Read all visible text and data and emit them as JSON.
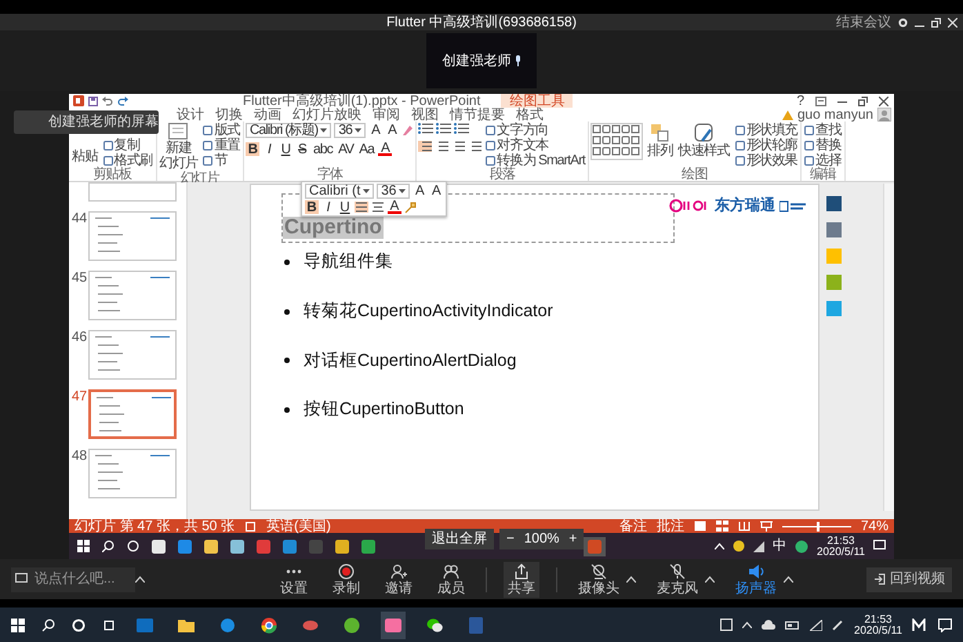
{
  "meeting": {
    "title": "Flutter 中高级培训(693686158)",
    "end_meeting": "结束会议",
    "video_tile_name": "创建强老师",
    "share_tooltip": "创建强老师的屏幕"
  },
  "powerpoint": {
    "title": "Flutter中高级培训(1).pptx - PowerPoint",
    "context_tab": "绘图工具",
    "help": "?",
    "user": "guo manyun",
    "tabs": [
      {
        "label": "设计",
        "selected": false
      },
      {
        "label": "切换",
        "selected": false
      },
      {
        "label": "动画",
        "selected": false
      },
      {
        "label": "幻灯片放映",
        "selected": false
      },
      {
        "label": "审阅",
        "selected": false
      },
      {
        "label": "视图",
        "selected": false
      },
      {
        "label": "情节提要",
        "selected": false
      },
      {
        "label": "格式",
        "selected": false
      }
    ],
    "ribbon": [
      {
        "kind": "clipboard",
        "label": "剪贴板",
        "large": [
          "粘贴"
        ],
        "small": [
          "复制",
          "格式刷"
        ]
      },
      {
        "kind": "slides",
        "label": "幻灯片",
        "large": [
          "新建",
          "幻灯片"
        ],
        "small": [
          "版式",
          "重置",
          "节"
        ]
      },
      {
        "kind": "font",
        "label": "字体",
        "font_name": "Calibri (标题)",
        "font_size": "36",
        "size_buttons": [
          "A",
          "A"
        ],
        "format_buttons": [
          "B",
          "I",
          "U",
          "S",
          "abc",
          "AV",
          "Aa",
          "A"
        ]
      },
      {
        "kind": "paragraph",
        "label": "段落",
        "small": [
          "文字方向",
          "对齐文本",
          "转换为 SmartArt"
        ]
      },
      {
        "kind": "drawing",
        "label": "绘图",
        "large": [
          "排列",
          "快速样式"
        ],
        "small": [
          "形状填充",
          "形状轮廓",
          "形状效果"
        ]
      },
      {
        "kind": "editing",
        "label": "编辑",
        "small": [
          "查找",
          "替换",
          "选择"
        ]
      }
    ],
    "mini_toolbar": {
      "font_name": "Calibri (t",
      "font_size": "36",
      "size_buttons": [
        "A",
        "A"
      ],
      "format_buttons": [
        "B",
        "I",
        "U"
      ],
      "font_color": "A"
    },
    "thumbnails": [
      {
        "number": "44",
        "selected": false
      },
      {
        "number": "45",
        "selected": false
      },
      {
        "number": "46",
        "selected": false
      },
      {
        "number": "47",
        "selected": true
      },
      {
        "number": "48",
        "selected": false
      }
    ],
    "slide": {
      "title": "Cupertino",
      "title_selected": true,
      "logo_text": "东方瑞通",
      "bullets": [
        "导航组件集",
        "转菊花CupertinoActivityIndicator",
        "对话框CupertinoAlertDialog",
        "按钮CupertinoButton"
      ]
    },
    "swatches": [
      {
        "color": "#1f4e79"
      },
      {
        "color": "#6d7b8d"
      },
      {
        "color": "#ffc000"
      },
      {
        "color": "#8cb21b"
      },
      {
        "color": "#1ea7e1"
      }
    ],
    "status_bar": {
      "slide_info": "幻灯片 第 47 张，共 50 张",
      "language": "英语(美国)",
      "notes": "备注",
      "comments": "批注",
      "zoom_slider": {
        "level": 0.5
      },
      "zoom": "74%"
    }
  },
  "share_controls": {
    "exit_fullscreen": "退出全屏",
    "zoom_out": "−",
    "zoom": "100%",
    "zoom_in": "+"
  },
  "remote_taskbar": {
    "ime": "中",
    "time": "21:53",
    "date": "2020/5/11"
  },
  "toolbar": {
    "chat_placeholder": "说点什么吧...",
    "actions": [
      {
        "kind": "settings",
        "label": "设置"
      },
      {
        "kind": "record",
        "label": "录制"
      },
      {
        "kind": "invite",
        "label": "邀请"
      },
      {
        "kind": "members",
        "label": "成员"
      }
    ],
    "share": {
      "label": "共享",
      "selected": true
    },
    "devices": [
      {
        "kind": "camera",
        "label": "摄像头",
        "on": false
      },
      {
        "kind": "mic",
        "label": "麦克风",
        "on": false
      },
      {
        "kind": "speaker",
        "label": "扬声器",
        "on": true
      }
    ],
    "back_to_video": "回到视频"
  },
  "taskbar": {
    "apps": [
      {
        "kind": "mail",
        "selected": false
      },
      {
        "kind": "folder",
        "selected": false
      },
      {
        "kind": "browser",
        "selected": false
      },
      {
        "kind": "chrome",
        "selected": false
      },
      {
        "kind": "red",
        "selected": false
      },
      {
        "kind": "green",
        "selected": false
      },
      {
        "kind": "pink",
        "selected": true
      },
      {
        "kind": "chat",
        "selected": false
      },
      {
        "kind": "word",
        "selected": false
      }
    ],
    "time": "21:53",
    "date": "2020/5/11"
  }
}
